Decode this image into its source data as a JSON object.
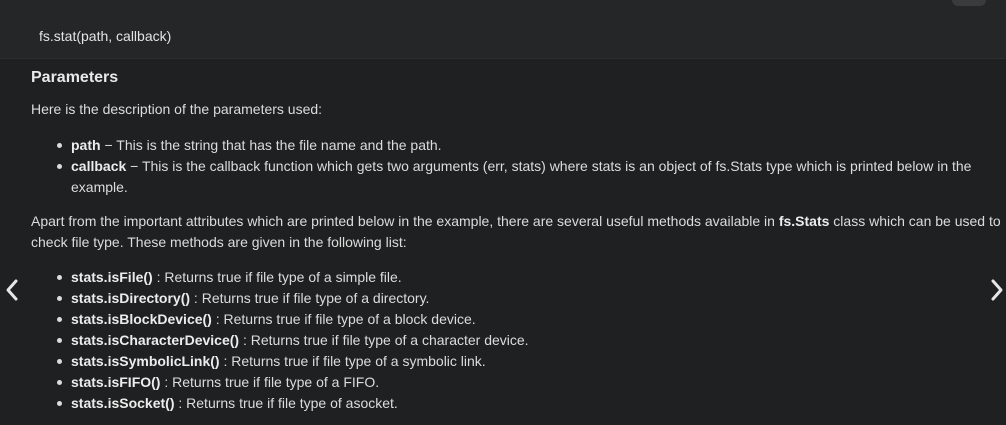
{
  "code_box": {
    "code": "fs.stat(path, callback)"
  },
  "heading": "Parameters",
  "intro": "Here is the description of the parameters used:",
  "params": [
    {
      "name": "path",
      "desc": " − This is the string that has the file name and the path."
    },
    {
      "name": "callback",
      "desc": " − This is the callback function which gets two arguments (err, stats) where stats is an object of fs.Stats type which is printed below in the example."
    }
  ],
  "apart": {
    "before": "Apart from the important attributes which are printed below in the example, there are several useful methods available in ",
    "bold": "fs.Stats",
    "after": " class which can be used to check file type. These methods are given in the following list:"
  },
  "methods": [
    {
      "name": "stats.isFile()",
      "desc": " : Returns true if file type of a simple file."
    },
    {
      "name": "stats.isDirectory()",
      "desc": " : Returns true if file type of a directory."
    },
    {
      "name": "stats.isBlockDevice()",
      "desc": " : Returns true if file type of a block device."
    },
    {
      "name": "stats.isCharacterDevice()",
      "desc": " : Returns true if file type of a character device."
    },
    {
      "name": "stats.isSymbolicLink()",
      "desc": " : Returns true if file type of a symbolic link."
    },
    {
      "name": "stats.isFIFO()",
      "desc": " : Returns true if file type of a FIFO."
    },
    {
      "name": "stats.isSocket()",
      "desc": " : Returns true if file type of asocket."
    }
  ],
  "nav": {
    "left_icon": "chevron-left-icon",
    "right_icon": "chevron-right-icon"
  }
}
